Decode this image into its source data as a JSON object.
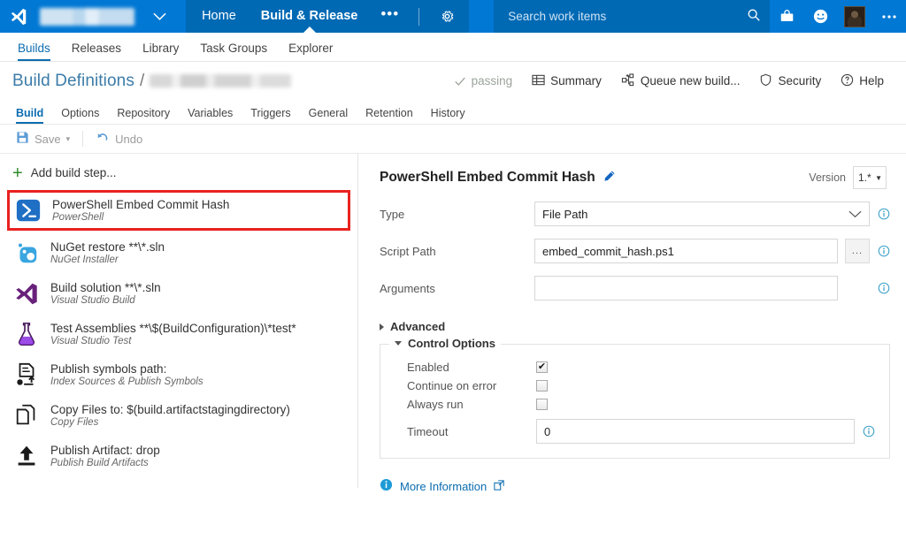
{
  "header": {
    "logo_icon": "visual-studio-logo",
    "org_name_redacted": "",
    "org_chevron_icon": "chevron-down-icon",
    "nav": [
      {
        "label": "Home",
        "active": false
      },
      {
        "label": "Build & Release",
        "active": true
      }
    ],
    "nav_overflow_label": "•••",
    "settings_icon": "gear-icon",
    "search": {
      "placeholder": "Search work items",
      "value": "",
      "icon": "search-icon"
    },
    "right_icons": [
      {
        "name": "marketplace-icon"
      },
      {
        "name": "feedback-smiley-icon"
      },
      {
        "name": "user-avatar"
      },
      {
        "name": "more-options-icon"
      }
    ]
  },
  "subnav": {
    "items": [
      {
        "label": "Builds",
        "active": true
      },
      {
        "label": "Releases",
        "active": false
      },
      {
        "label": "Library",
        "active": false
      },
      {
        "label": "Task Groups",
        "active": false
      },
      {
        "label": "Explorer",
        "active": false
      }
    ]
  },
  "breadcrumb": {
    "root": "Build Definitions",
    "separator": "/",
    "definition_name_redacted": ""
  },
  "command_bar": {
    "status": {
      "label": "passing",
      "icon": "check-icon"
    },
    "items": [
      {
        "label": "Summary",
        "icon": "table-icon"
      },
      {
        "label": "Queue new build...",
        "icon": "queue-build-icon"
      },
      {
        "label": "Security",
        "icon": "shield-icon"
      },
      {
        "label": "Help",
        "icon": "question-circle-icon"
      }
    ]
  },
  "definition_tabs": {
    "items": [
      {
        "label": "Build",
        "active": true
      },
      {
        "label": "Options",
        "active": false
      },
      {
        "label": "Repository",
        "active": false
      },
      {
        "label": "Variables",
        "active": false
      },
      {
        "label": "Triggers",
        "active": false
      },
      {
        "label": "General",
        "active": false
      },
      {
        "label": "Retention",
        "active": false
      },
      {
        "label": "History",
        "active": false
      }
    ]
  },
  "save_bar": {
    "save_label": "Save",
    "save_icon": "floppy-disk-icon",
    "save_caret": "▾",
    "undo_label": "Undo",
    "undo_icon": "undo-arrow-icon"
  },
  "steps_panel": {
    "add_step_label": "Add build step...",
    "add_step_icon": "plus-icon",
    "steps": [
      {
        "title": "PowerShell Embed Commit Hash",
        "subtitle": "PowerShell",
        "icon": "powershell-icon",
        "selected": true
      },
      {
        "title": "NuGet restore **\\*.sln",
        "subtitle": "NuGet Installer",
        "icon": "nuget-icon",
        "selected": false
      },
      {
        "title": "Build solution **\\*.sln",
        "subtitle": "Visual Studio Build",
        "icon": "visual-studio-icon",
        "selected": false
      },
      {
        "title": "Test Assemblies **\\$(BuildConfiguration)\\*test*",
        "subtitle": "Visual Studio Test",
        "icon": "flask-icon",
        "selected": false
      },
      {
        "title": "Publish symbols path:",
        "subtitle": "Index Sources & Publish Symbols",
        "icon": "publish-symbols-icon",
        "selected": false
      },
      {
        "title": "Copy Files to: $(build.artifactstagingdirectory)",
        "subtitle": "Copy Files",
        "icon": "copy-files-icon",
        "selected": false
      },
      {
        "title": "Publish Artifact: drop",
        "subtitle": "Publish Build Artifacts",
        "icon": "upload-arrow-icon",
        "selected": false
      }
    ]
  },
  "detail": {
    "title": "PowerShell Embed Commit Hash",
    "edit_icon": "pencil-icon",
    "version_label": "Version",
    "version_value": "1.*",
    "version_caret": "▼",
    "fields": {
      "type": {
        "label": "Type",
        "value": "File Path",
        "info_icon": "info-icon",
        "chevron_icon": "chevron-down-icon"
      },
      "script_path": {
        "label": "Script Path",
        "value": "embed_commit_hash.ps1",
        "browse_label": "...",
        "info_icon": "info-icon"
      },
      "arguments": {
        "label": "Arguments",
        "value": "",
        "placeholder": "",
        "info_icon": "info-icon"
      }
    },
    "advanced": {
      "label": "Advanced",
      "expanded": false
    },
    "control_options": {
      "legend": "Control Options",
      "expanded": true,
      "enabled": {
        "label": "Enabled",
        "checked": true
      },
      "continue_on_error": {
        "label": "Continue on error",
        "checked": false
      },
      "always_run": {
        "label": "Always run",
        "checked": false
      },
      "timeout": {
        "label": "Timeout",
        "value": "0",
        "info_icon": "info-icon"
      }
    },
    "more_information": {
      "label": "More Information",
      "info_icon": "info-circle-icon",
      "external_icon": "external-link-icon"
    }
  },
  "colors": {
    "header_blue": "#0078d4",
    "header_blue_dark": "#0069b4",
    "accent_link": "#0b6cb0",
    "highlight_red": "#e8221f",
    "green_plus": "#2e8b2e",
    "powershell_blue": "#1f6fc4",
    "vs_purple": "#68217a",
    "info_teal": "#3aa0c8"
  }
}
